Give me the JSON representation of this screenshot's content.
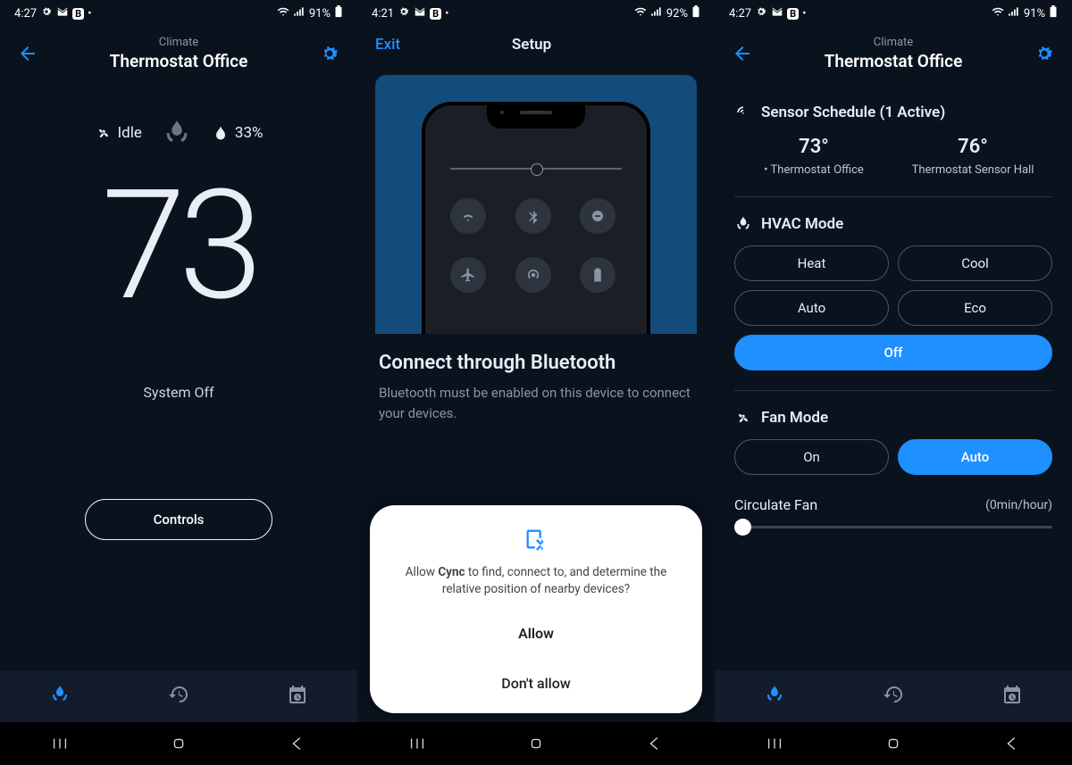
{
  "s1": {
    "status": {
      "time": "4:27",
      "battery": "91%"
    },
    "header": {
      "subtitle": "Climate",
      "title": "Thermostat Office"
    },
    "state": {
      "fan": "Idle",
      "humidity": "33%"
    },
    "temp": "73",
    "system": "System Off",
    "controls": "Controls"
  },
  "s2": {
    "status": {
      "time": "4:21",
      "battery": "92%"
    },
    "exit": "Exit",
    "title": "Setup",
    "heading": "Connect through Bluetooth",
    "body": "Bluetooth must be enabled on this device to connect your devices.",
    "dialog": {
      "text_pre": "Allow ",
      "app": "Cync",
      "text_post": " to find, connect to, and determine the relative position of nearby devices?",
      "allow": "Allow",
      "deny": "Don't allow"
    }
  },
  "s3": {
    "status": {
      "time": "4:27",
      "battery": "91%"
    },
    "header": {
      "subtitle": "Climate",
      "title": "Thermostat Office"
    },
    "sensor_title": "Sensor Schedule (1 Active)",
    "sensors": [
      {
        "temp": "73°",
        "name": "Thermostat Office",
        "active": true
      },
      {
        "temp": "76°",
        "name": "Thermostat Sensor Hall",
        "active": false
      }
    ],
    "hvac_title": "HVAC Mode",
    "hvac_modes": [
      "Heat",
      "Cool",
      "Auto",
      "Eco",
      "Off"
    ],
    "hvac_selected": "Off",
    "fan_title": "Fan Mode",
    "fan_modes": [
      "On",
      "Auto"
    ],
    "fan_selected": "Auto",
    "circ_label": "Circulate Fan",
    "circ_value": "(0min/hour)"
  }
}
